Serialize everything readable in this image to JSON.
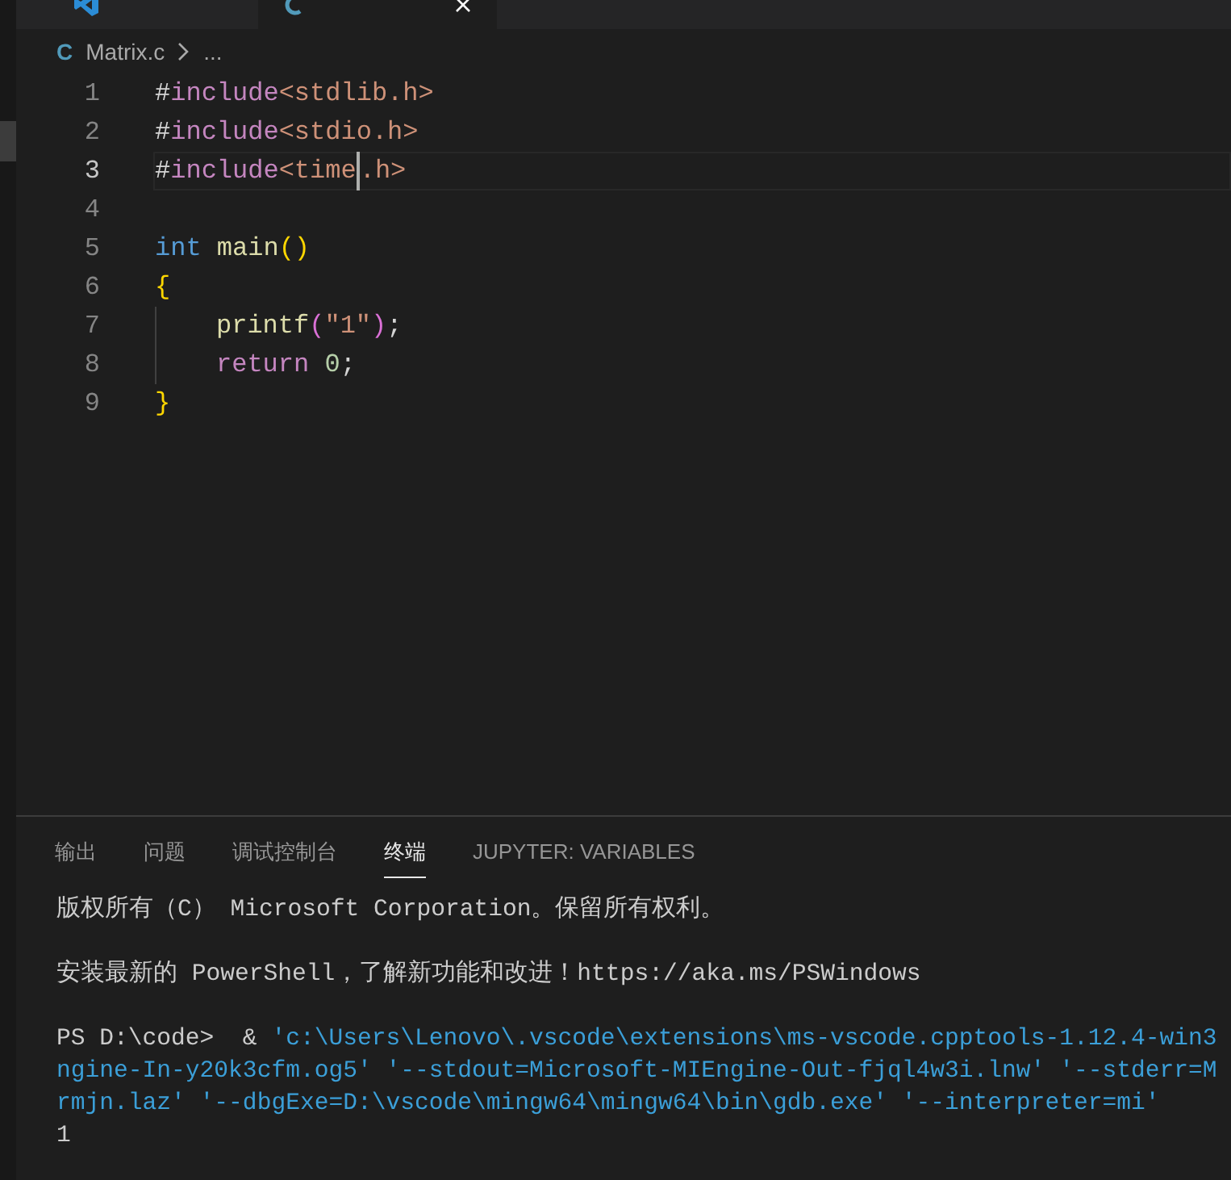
{
  "editor_tabs": [
    {
      "kind": "welcome",
      "selected": false
    },
    {
      "kind": "file",
      "selected": true
    }
  ],
  "breadcrumb": {
    "language": "C",
    "file": "Matrix.c",
    "more": "..."
  },
  "code_lines": [
    {
      "number": "1",
      "current": false,
      "indent": false,
      "tokens": [
        {
          "text": "#",
          "kind": "plain"
        },
        {
          "text": "include",
          "kind": "keyword"
        },
        {
          "text": "<stdlib.h>",
          "kind": "string"
        }
      ]
    },
    {
      "number": "2",
      "current": false,
      "indent": false,
      "tokens": [
        {
          "text": "#",
          "kind": "plain"
        },
        {
          "text": "include",
          "kind": "keyword"
        },
        {
          "text": "<stdio.h>",
          "kind": "string"
        }
      ]
    },
    {
      "number": "3",
      "current": true,
      "indent": false,
      "tokens": [
        {
          "text": "#",
          "kind": "plain"
        },
        {
          "text": "include",
          "kind": "keyword"
        },
        {
          "text": "<time",
          "kind": "string",
          "cursor_after": true
        },
        {
          "text": ".h>",
          "kind": "string"
        }
      ]
    },
    {
      "number": "4",
      "current": false
    },
    {
      "number": "5",
      "current": false,
      "indent": false,
      "tokens": [
        {
          "text": "int ",
          "kind": "type"
        },
        {
          "text": "main",
          "kind": "function"
        },
        {
          "text": "()",
          "kind": "bracket1"
        }
      ]
    },
    {
      "number": "6",
      "current": false,
      "indent": false,
      "tokens": [
        {
          "text": "{",
          "kind": "bracket1"
        }
      ]
    },
    {
      "number": "7",
      "current": false,
      "indent": true,
      "tokens": [
        {
          "text": "printf",
          "kind": "function"
        },
        {
          "text": "(",
          "kind": "bracket2"
        },
        {
          "text": "\"1\"",
          "kind": "string"
        },
        {
          "text": ")",
          "kind": "bracket2"
        },
        {
          "text": ";",
          "kind": "plain"
        }
      ]
    },
    {
      "number": "8",
      "current": false,
      "indent": true,
      "tokens": [
        {
          "text": "return ",
          "kind": "keyword"
        },
        {
          "text": "0",
          "kind": "number"
        },
        {
          "text": ";",
          "kind": "plain"
        }
      ]
    },
    {
      "number": "9",
      "current": false,
      "indent": false,
      "tokens": [
        {
          "text": "}",
          "kind": "bracket1"
        }
      ]
    }
  ],
  "panel_tabs": [
    {
      "label": "输出",
      "selected": false
    },
    {
      "label": "问题",
      "selected": false
    },
    {
      "label": "调试控制台",
      "selected": false
    },
    {
      "label": "终端",
      "selected": true
    },
    {
      "label": "JUPYTER: VARIABLES",
      "selected": false
    }
  ],
  "terminal_lines": [
    {
      "segments": [
        {
          "text": "版权所有（C） Microsoft Corporation。保留所有权利。",
          "kind": "plain"
        }
      ]
    },
    {
      "kind": "blank"
    },
    {
      "segments": [
        {
          "text": "安装最新的 PowerShell，了解新功能和改进！https://aka.ms/PSWindows",
          "kind": "plain"
        }
      ]
    },
    {
      "kind": "blank"
    },
    {
      "segments": [
        {
          "text": "PS D:\\code>  & ",
          "kind": "plain"
        },
        {
          "text": "'c:\\Users\\Lenovo\\.vscode\\extensions\\ms-vscode.cpptools-1.12.4-win3",
          "kind": "link"
        }
      ]
    },
    {
      "segments": [
        {
          "text": "ngine-In-y20k3cfm.og5' '--stdout=Microsoft-MIEngine-Out-fjql4w3i.lnw' '--stderr=M",
          "kind": "link"
        }
      ]
    },
    {
      "segments": [
        {
          "text": "rmjn.laz' '--dbgExe=D:\\vscode\\mingw64\\mingw64\\bin\\gdb.exe' '--interpreter=mi'",
          "kind": "link"
        }
      ]
    },
    {
      "segments": [
        {
          "text": "1",
          "kind": "plain"
        }
      ]
    }
  ]
}
